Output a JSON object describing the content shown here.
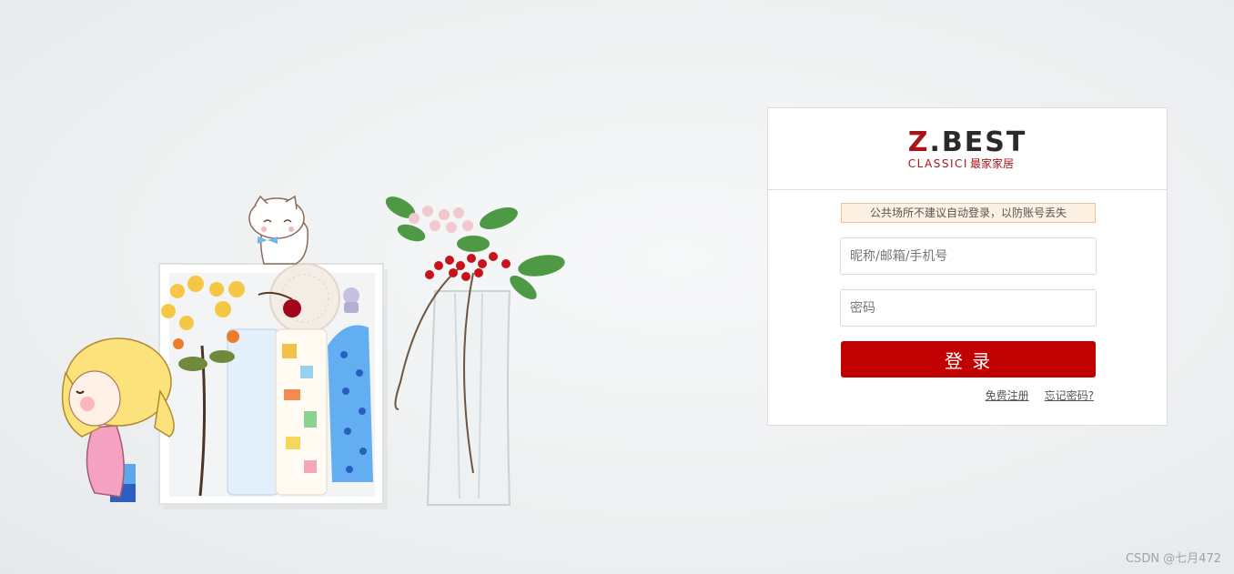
{
  "logo": {
    "main_prefix": "Z",
    "main_rest": ".BEST",
    "sub_en": "CLASSICI",
    "sub_cn": "最家家居",
    "brand_color": "#a8141a"
  },
  "notice": {
    "text": "公共场所不建议自动登录，以防账号丢失",
    "bg_color": "#fdf1e3",
    "border_color": "#efc592"
  },
  "form": {
    "username_placeholder": "昵称/邮箱/手机号",
    "username_value": "",
    "password_placeholder": "密码",
    "password_value": "",
    "login_label": "登 录",
    "login_color": "#c10000"
  },
  "links": {
    "register": "免费注册",
    "forgot": "忘记密码?"
  },
  "watermark": "CSDN @七月472",
  "background": {
    "illustration": "girl-cat-flowers-box-vase"
  }
}
